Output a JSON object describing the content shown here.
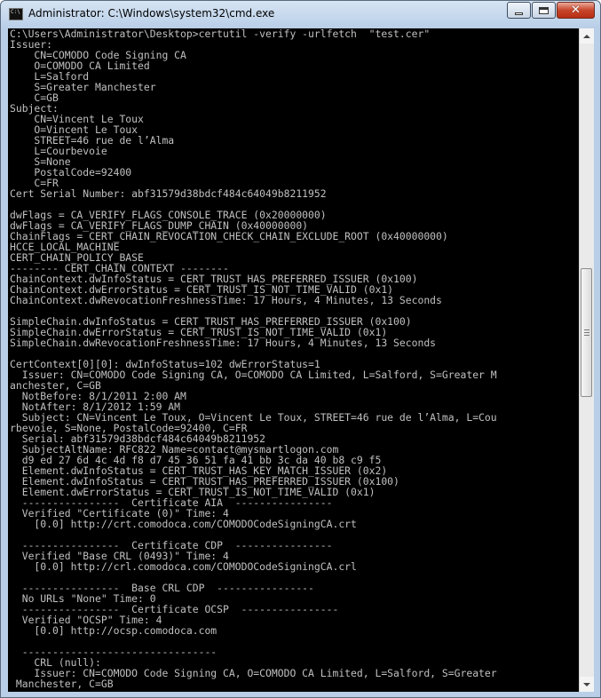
{
  "window": {
    "title": "Administrator: C:\\Windows\\system32\\cmd.exe",
    "icon": "console-icon",
    "controls": {
      "minimize": "minimize-icon",
      "maximize": "maximize-icon",
      "close": "close-icon"
    }
  },
  "colors": {
    "console_bg": "#000000",
    "console_fg": "#c0c0c0",
    "close_button": "#c7452a"
  },
  "console": {
    "text": "C:\\Users\\Administrator\\Desktop>certutil -verify -urlfetch  \"test.cer\"\nIssuer:\n    CN=COMODO Code Signing CA\n    O=COMODO CA Limited\n    L=Salford\n    S=Greater Manchester\n    C=GB\nSubject:\n    CN=Vincent Le Toux\n    O=Vincent Le Toux\n    STREET=46 rue de l’Alma\n    L=Courbevoie\n    S=None\n    PostalCode=92400\n    C=FR\nCert Serial Number: abf31579d38bdcf484c64049b8211952\n\ndwFlags = CA_VERIFY_FLAGS_CONSOLE_TRACE (0x20000000)\ndwFlags = CA_VERIFY_FLAGS_DUMP_CHAIN (0x40000000)\nChainFlags = CERT_CHAIN_REVOCATION_CHECK_CHAIN_EXCLUDE_ROOT (0x40000000)\nHCCE_LOCAL_MACHINE\nCERT_CHAIN_POLICY_BASE\n-------- CERT_CHAIN_CONTEXT --------\nChainContext.dwInfoStatus = CERT_TRUST_HAS_PREFERRED_ISSUER (0x100)\nChainContext.dwErrorStatus = CERT_TRUST_IS_NOT_TIME_VALID (0x1)\nChainContext.dwRevocationFreshnessTime: 17 Hours, 4 Minutes, 13 Seconds\n\nSimpleChain.dwInfoStatus = CERT_TRUST_HAS_PREFERRED_ISSUER (0x100)\nSimpleChain.dwErrorStatus = CERT_TRUST_IS_NOT_TIME_VALID (0x1)\nSimpleChain.dwRevocationFreshnessTime: 17 Hours, 4 Minutes, 13 Seconds\n\nCertContext[0][0]: dwInfoStatus=102 dwErrorStatus=1\n  Issuer: CN=COMODO Code Signing CA, O=COMODO CA Limited, L=Salford, S=Greater M\nanchester, C=GB\n  NotBefore: 8/1/2011 2:00 AM\n  NotAfter: 8/1/2012 1:59 AM\n  Subject: CN=Vincent Le Toux, O=Vincent Le Toux, STREET=46 rue de l’Alma, L=Cou\nrbevoie, S=None, PostalCode=92400, C=FR\n  Serial: abf31579d38bdcf484c64049b8211952\n  SubjectAltName: RFC822 Name=contact@mysmartlogon.com\n  d9 ed 27 6d 4c 4d f8 d7 45 36 51 fa 41 bb 3c da 40 b8 c9 f5\n  Element.dwInfoStatus = CERT_TRUST_HAS_KEY_MATCH_ISSUER (0x2)\n  Element.dwInfoStatus = CERT_TRUST_HAS_PREFERRED_ISSUER (0x100)\n  Element.dwErrorStatus = CERT_TRUST_IS_NOT_TIME_VALID (0x1)\n  ----------------  Certificate AIA  ----------------\n  Verified \"Certificate (0)\" Time: 4\n    [0.0] http://crt.comodoca.com/COMODOCodeSigningCA.crt\n\n  ----------------  Certificate CDP  ----------------\n  Verified \"Base CRL (0493)\" Time: 4\n    [0.0] http://crl.comodoca.com/COMODOCodeSigningCA.crl\n\n  ----------------  Base CRL CDP  ----------------\n  No URLs \"None\" Time: 0\n  ----------------  Certificate OCSP  ----------------\n  Verified \"OCSP\" Time: 4\n    [0.0] http://ocsp.comodoca.com\n\n  --------------------------------\n    CRL (null):\n    Issuer: CN=COMODO Code Signing CA, O=COMODO CA Limited, L=Salford, S=Greater\n Manchester, C=GB"
  },
  "scrollbar": {
    "up_icon": "scroll-up-arrow-icon",
    "down_icon": "scroll-down-arrow-icon",
    "position_fraction": 0.38
  }
}
